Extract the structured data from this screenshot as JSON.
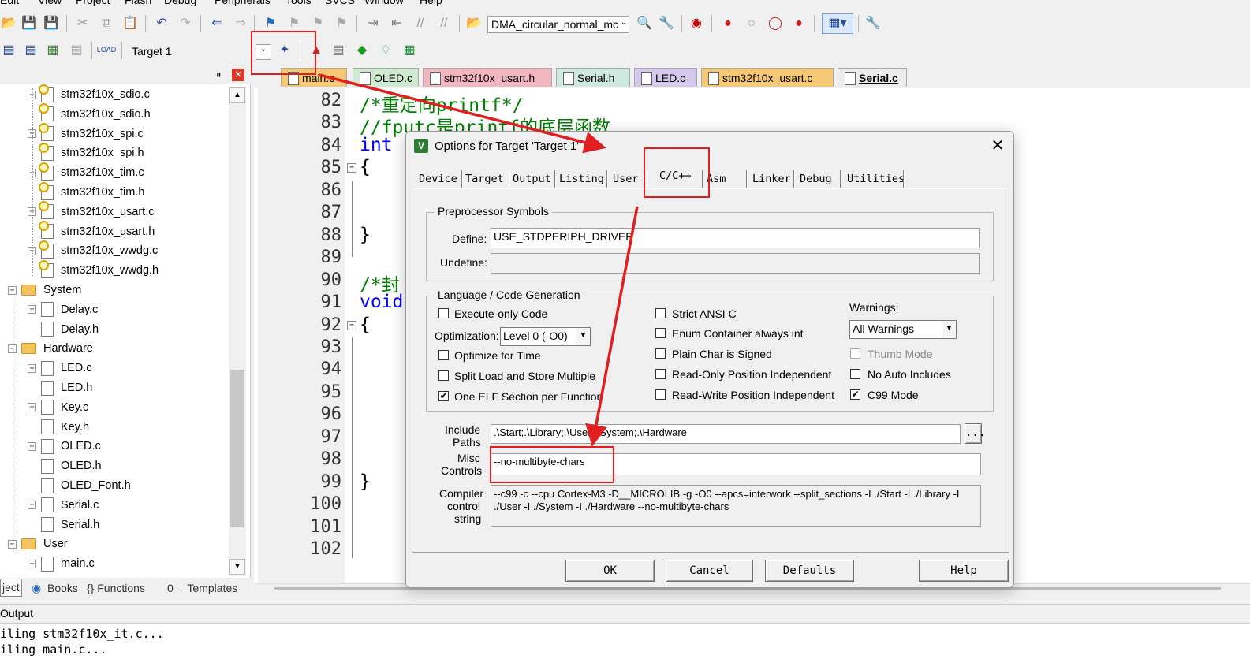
{
  "menubar": [
    "Edit",
    "View",
    "Project",
    "Flash",
    "Debug",
    "Peripherals",
    "Tools",
    "SVCS",
    "Window",
    "Help"
  ],
  "toolbar": {
    "project_combo": "DMA_circular_normal_mc",
    "target_combo": "Target 1"
  },
  "project_tree": [
    {
      "label": "stm32f10x_sdio.c",
      "kind": "file",
      "key": true,
      "expand": "+"
    },
    {
      "label": "stm32f10x_sdio.h",
      "kind": "file",
      "key": true,
      "expand": ""
    },
    {
      "label": "stm32f10x_spi.c",
      "kind": "file",
      "key": true,
      "expand": "+"
    },
    {
      "label": "stm32f10x_spi.h",
      "kind": "file",
      "key": true,
      "expand": ""
    },
    {
      "label": "stm32f10x_tim.c",
      "kind": "file",
      "key": true,
      "expand": "+"
    },
    {
      "label": "stm32f10x_tim.h",
      "kind": "file",
      "key": true,
      "expand": ""
    },
    {
      "label": "stm32f10x_usart.c",
      "kind": "file",
      "key": true,
      "expand": "+"
    },
    {
      "label": "stm32f10x_usart.h",
      "kind": "file",
      "key": true,
      "expand": ""
    },
    {
      "label": "stm32f10x_wwdg.c",
      "kind": "file",
      "key": true,
      "expand": "+"
    },
    {
      "label": "stm32f10x_wwdg.h",
      "kind": "file",
      "key": true,
      "expand": ""
    },
    {
      "label": "System",
      "kind": "folder",
      "expand": "-"
    },
    {
      "label": "Delay.c",
      "kind": "file",
      "key": false,
      "expand": "+"
    },
    {
      "label": "Delay.h",
      "kind": "file",
      "key": false,
      "expand": ""
    },
    {
      "label": "Hardware",
      "kind": "folder",
      "expand": "-"
    },
    {
      "label": "LED.c",
      "kind": "file",
      "key": false,
      "expand": "+"
    },
    {
      "label": "LED.h",
      "kind": "file",
      "key": false,
      "expand": ""
    },
    {
      "label": "Key.c",
      "kind": "file",
      "key": false,
      "expand": "+"
    },
    {
      "label": "Key.h",
      "kind": "file",
      "key": false,
      "expand": ""
    },
    {
      "label": "OLED.c",
      "kind": "file",
      "key": false,
      "expand": "+"
    },
    {
      "label": "OLED.h",
      "kind": "file",
      "key": false,
      "expand": ""
    },
    {
      "label": "OLED_Font.h",
      "kind": "file",
      "key": false,
      "expand": ""
    },
    {
      "label": "Serial.c",
      "kind": "file",
      "key": false,
      "expand": "+"
    },
    {
      "label": "Serial.h",
      "kind": "file",
      "key": false,
      "expand": ""
    },
    {
      "label": "User",
      "kind": "folder",
      "expand": "-"
    },
    {
      "label": "main.c",
      "kind": "file",
      "key": false,
      "expand": "+"
    }
  ],
  "project_tabs": [
    "ject",
    "Books",
    "{} Functions",
    "0→ Templates"
  ],
  "editor_tabs": [
    {
      "label": "main.c",
      "color": "#f7c873"
    },
    {
      "label": "OLED.c",
      "color": "#cfe8d0"
    },
    {
      "label": "stm32f10x_usart.h",
      "color": "#f2b6c0"
    },
    {
      "label": "Serial.h",
      "color": "#cfe8e0"
    },
    {
      "label": "LED.c",
      "color": "#d4c8ec"
    },
    {
      "label": "stm32f10x_usart.c",
      "color": "#f7c873"
    },
    {
      "label": "Serial.c",
      "color": "#ececec"
    }
  ],
  "code_lines": [
    {
      "num": "82",
      "text": "/*重定向printf*/",
      "color": "#008000"
    },
    {
      "num": "83",
      "text": "//fputc是printf的底层函数",
      "color": "#008000"
    },
    {
      "num": "84",
      "text": "int",
      "color": "#0000ff"
    },
    {
      "num": "85",
      "text": "{",
      "color": "#000000"
    },
    {
      "num": "86",
      "text": "",
      "color": "#000000"
    },
    {
      "num": "87",
      "text": "",
      "color": "#000000"
    },
    {
      "num": "88",
      "text": "}",
      "color": "#000000"
    },
    {
      "num": "89",
      "text": "",
      "color": "#000000"
    },
    {
      "num": "90",
      "text": "/*封",
      "color": "#008000"
    },
    {
      "num": "91",
      "text": "void",
      "color": "#0000ff"
    },
    {
      "num": "92",
      "text": "{",
      "color": "#000000"
    },
    {
      "num": "93",
      "text": "",
      "color": "#000000"
    },
    {
      "num": "94",
      "text": "",
      "color": "#000000"
    },
    {
      "num": "95",
      "text": "",
      "color": "#000000"
    },
    {
      "num": "96",
      "text": "",
      "color": "#000000"
    },
    {
      "num": "97",
      "text": "",
      "color": "#000000"
    },
    {
      "num": "98",
      "text": "",
      "color": "#000000"
    },
    {
      "num": "99",
      "text": "}",
      "color": "#000000"
    },
    {
      "num": "100",
      "text": "",
      "color": "#000000"
    },
    {
      "num": "101",
      "text": "",
      "color": "#000000"
    },
    {
      "num": "102",
      "text": "",
      "color": "#000000"
    }
  ],
  "output": {
    "title": "Output",
    "lines": [
      "iling stm32f10x_it.c...",
      "iling main.c..."
    ]
  },
  "dialog": {
    "title": "Options for Target 'Target 1'",
    "tabs": [
      "Device",
      "Target",
      "Output",
      "Listing",
      "User",
      "C/C++",
      "Asm",
      "Linker",
      "Debug",
      "Utilities"
    ],
    "active_tab": "C/C++",
    "preprocessor": {
      "group_label": "Preprocessor Symbols",
      "define_label": "Define:",
      "define_value": "USE_STDPERIPH_DRIVER",
      "undefine_label": "Undefine:",
      "undefine_value": ""
    },
    "language": {
      "group_label": "Language / Code Generation",
      "execute_only": {
        "label": "Execute-only Code",
        "checked": false
      },
      "optimization_label": "Optimization:",
      "optimization_value": "Level 0 (-O0)",
      "optimize_time": {
        "label": "Optimize for Time",
        "checked": false
      },
      "split_load": {
        "label": "Split Load and Store Multiple",
        "checked": false
      },
      "one_elf": {
        "label": "One ELF Section per Function",
        "checked": true
      },
      "strict_ansi": {
        "label": "Strict ANSI C",
        "checked": false
      },
      "enum_int": {
        "label": "Enum Container always int",
        "checked": false
      },
      "plain_char": {
        "label": "Plain Char is Signed",
        "checked": false
      },
      "ro_pi": {
        "label": "Read-Only Position Independent",
        "checked": false
      },
      "rw_pi": {
        "label": "Read-Write Position Independent",
        "checked": false
      },
      "warnings_label": "Warnings:",
      "warnings_value": "All Warnings",
      "thumb_mode": {
        "label": "Thumb Mode",
        "checked": false
      },
      "no_auto_includes": {
        "label": "No Auto Includes",
        "checked": false
      },
      "c99_mode": {
        "label": "C99 Mode",
        "checked": true
      }
    },
    "include_paths_label_1": "Include",
    "include_paths_label_2": "Paths",
    "include_paths_value": ".\\Start;.\\Library;.\\User;.\\System;.\\Hardware",
    "browse_label": "...",
    "misc_label_1": "Misc",
    "misc_label_2": "Controls",
    "misc_value": "--no-multibyte-chars",
    "compiler_label_1": "Compiler",
    "compiler_label_2": "control",
    "compiler_label_3": "string",
    "compiler_value_1": "--c99 -c --cpu Cortex-M3 -D__MICROLIB -g -O0 --apcs=interwork --split_sections -I ./Start -I ./Library -I",
    "compiler_value_2": "./User -I ./System -I ./Hardware --no-multibyte-chars",
    "buttons": {
      "ok": "OK",
      "cancel": "Cancel",
      "defaults": "Defaults",
      "help": "Help"
    }
  },
  "annotation_color": "#e02020"
}
